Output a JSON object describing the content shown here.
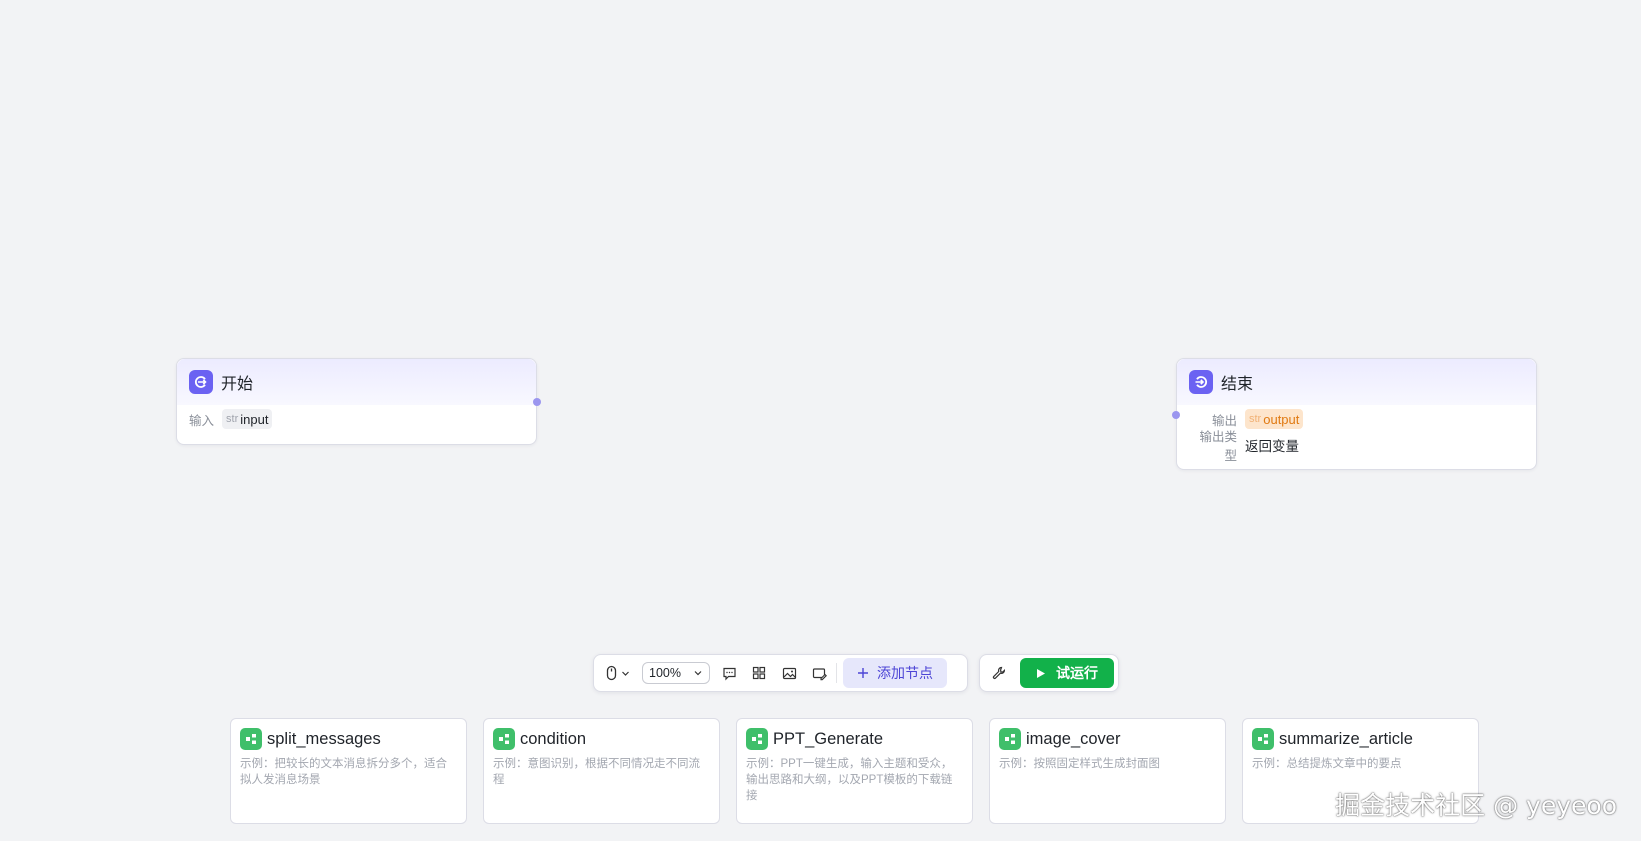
{
  "nodes": {
    "start": {
      "title": "开始",
      "input_label": "输入",
      "input_var": {
        "type": "str",
        "name": "input"
      }
    },
    "end": {
      "title": "结束",
      "output_label": "输出",
      "output_var": {
        "type": "str",
        "name": "output"
      },
      "output_type_label": "输出类型",
      "output_type_value": "返回变量"
    }
  },
  "toolbar": {
    "zoom": "100%",
    "add_node_label": "添加节点",
    "run_label": "试运行",
    "icons": [
      "mouse-icon",
      "chevron-down-icon",
      "comment-icon",
      "grid-icon",
      "image-icon",
      "image-edit-icon",
      "plus-icon",
      "wrench-icon",
      "play-icon"
    ]
  },
  "templates": [
    {
      "title": "split_messages",
      "desc": "示例：把较长的文本消息拆分多个，适合拟人发消息场景"
    },
    {
      "title": "condition",
      "desc": "示例：意图识别，根据不同情况走不同流程"
    },
    {
      "title": "PPT_Generate",
      "desc": "示例：PPT一键生成，输入主题和受众，输出思路和大纲，以及PPT模板的下载链接"
    },
    {
      "title": "image_cover",
      "desc": "示例：按照固定样式生成封面图"
    },
    {
      "title": "summarize_article",
      "desc": "示例：总结提炼文章中的要点"
    }
  ],
  "colors": {
    "accent": "#6b62f2",
    "run": "#12b14a",
    "template_icon": "#3fbf6a",
    "canvas": "#f2f3f5"
  },
  "watermark": "掘金技术社区 @ yeyeoo"
}
